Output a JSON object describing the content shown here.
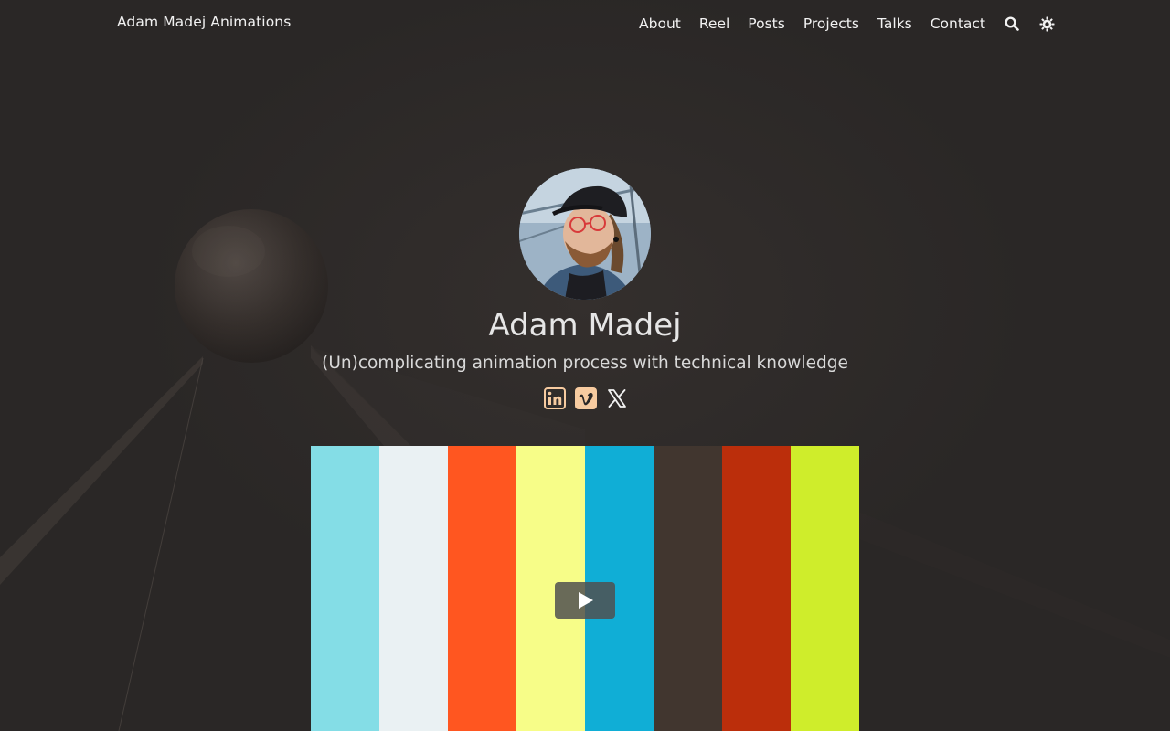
{
  "header": {
    "brand": "Adam Madej Animations",
    "nav": [
      {
        "label": "About"
      },
      {
        "label": "Reel"
      },
      {
        "label": "Posts"
      },
      {
        "label": "Projects"
      },
      {
        "label": "Talks"
      },
      {
        "label": "Contact"
      }
    ],
    "icons": [
      "search-icon",
      "theme-toggle-icon"
    ]
  },
  "hero": {
    "name": "Adam Madej",
    "tagline": "(Un)complicating animation process with technical knowledge",
    "socials": [
      {
        "icon": "linkedin-icon",
        "label": "LinkedIn"
      },
      {
        "icon": "vimeo-icon",
        "label": "Vimeo"
      },
      {
        "icon": "x-icon",
        "label": "X"
      }
    ]
  },
  "video": {
    "bar_colors": [
      "#84dde6",
      "#eaf1f3",
      "#ff5620",
      "#f7fd88",
      "#10aed6",
      "#41362f",
      "#bb2e0b",
      "#cfed2b"
    ],
    "play_icon": "play-icon"
  },
  "colors": {
    "background": "#2a2726",
    "social_accent": "#f7cba0",
    "text": "#f2f2f2"
  }
}
